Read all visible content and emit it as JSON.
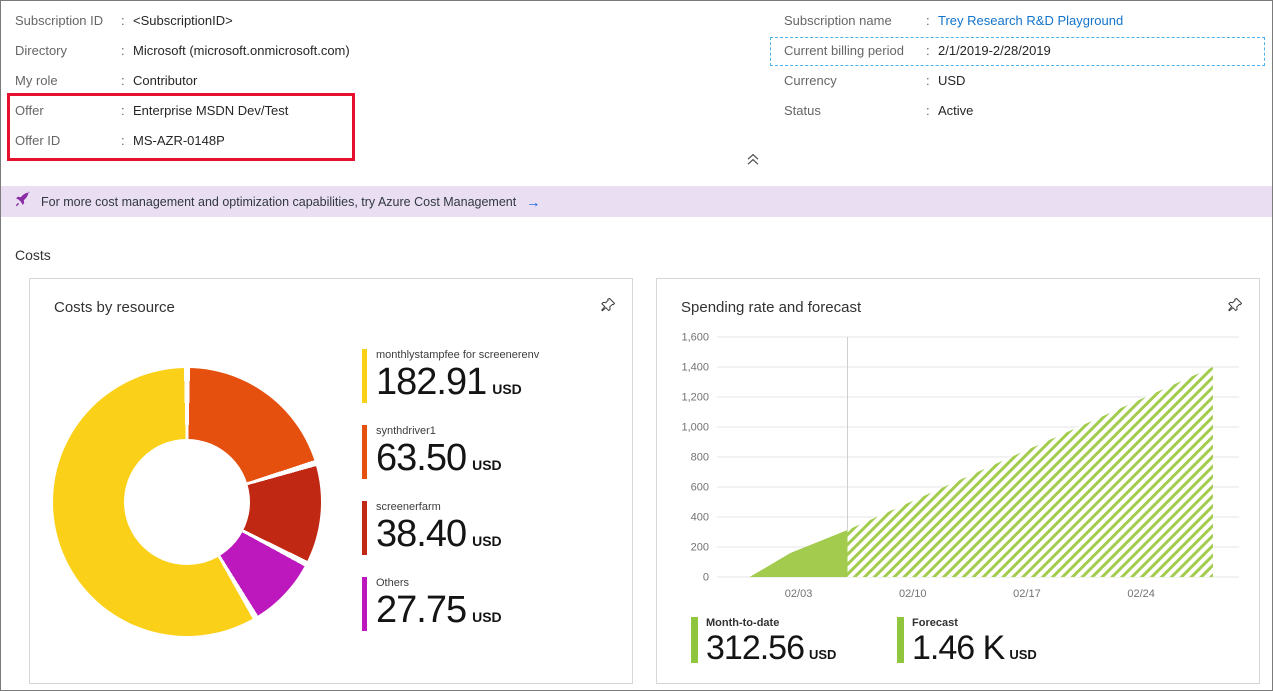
{
  "ui": {
    "colon": ":"
  },
  "details": {
    "left": [
      {
        "label": "Subscription ID",
        "value": "<SubscriptionID>"
      },
      {
        "label": "Directory",
        "value": "Microsoft (microsoft.onmicrosoft.com)"
      },
      {
        "label": "My role",
        "value": "Contributor"
      },
      {
        "label": "Offer",
        "value": "Enterprise MSDN Dev/Test"
      },
      {
        "label": "Offer ID",
        "value": "MS-AZR-0148P"
      }
    ],
    "right": [
      {
        "label": "Subscription name",
        "value": "Trey Research R&D Playground"
      },
      {
        "label": "Current billing period",
        "value": "2/1/2019-2/28/2019"
      },
      {
        "label": "Currency",
        "value": "USD"
      },
      {
        "label": "Status",
        "value": "Active"
      }
    ]
  },
  "banner": {
    "text": "For more cost management and optimization capabilities, try Azure Cost Management",
    "arrow": "→",
    "icon_color": "#8a2da5",
    "background": "#e9def2"
  },
  "section_title": "Costs",
  "chart_data": [
    {
      "type": "pie",
      "title": "Costs by resource",
      "donut_order": [
        1,
        2,
        3,
        0
      ],
      "series": [
        {
          "label": "monthlystampfee for screenerenv",
          "value": 182.91,
          "display": "182.91",
          "unit": "USD",
          "color": "#fbd019"
        },
        {
          "label": "synthdriver1",
          "value": 63.5,
          "display": "63.50",
          "unit": "USD",
          "color": "#e6500f"
        },
        {
          "label": "screenerfarm",
          "value": 38.4,
          "display": "38.40",
          "unit": "USD",
          "color": "#c02814"
        },
        {
          "label": "Others",
          "value": 27.75,
          "display": "27.75",
          "unit": "USD",
          "color": "#bd18bd"
        }
      ]
    },
    {
      "type": "area",
      "title": "Spending rate and forecast",
      "ylim": [
        0,
        1600
      ],
      "yticks": [
        0,
        200,
        400,
        600,
        800,
        1000,
        1200,
        1400,
        1600
      ],
      "xdomain": [
        -2,
        30
      ],
      "xticks": [
        {
          "label": "02/03",
          "day": 3
        },
        {
          "label": "02/10",
          "day": 10
        },
        {
          "label": "02/17",
          "day": 17
        },
        {
          "label": "02/24",
          "day": 24
        }
      ],
      "today_day": 6,
      "actual": {
        "name": "Month-to-date",
        "color": "#a3cc4e",
        "points": [
          [
            0,
            0
          ],
          [
            2.5,
            160
          ],
          [
            6,
            313
          ]
        ]
      },
      "forecast": {
        "name": "Forecast",
        "color": "#a3cc4e",
        "points": [
          [
            6,
            313
          ],
          [
            28.4,
            1400
          ]
        ]
      },
      "stats": [
        {
          "label": "Month-to-date",
          "value": "312.56",
          "unit": "USD",
          "marker": "solid"
        },
        {
          "label": "Forecast",
          "value": "1.46 K",
          "unit": "USD",
          "marker": "solid"
        }
      ]
    }
  ]
}
